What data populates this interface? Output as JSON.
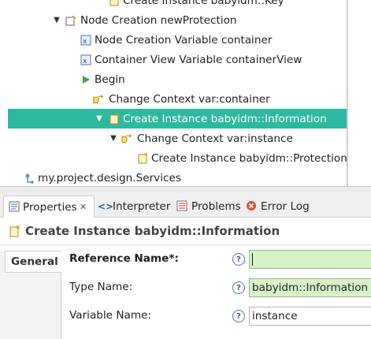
{
  "tree": {
    "rows": [
      {
        "label": "Create Instance babyidm::Key",
        "icon": "create-instance-icon"
      },
      {
        "label": "Node Creation newProtection",
        "icon": "node-creation-icon"
      },
      {
        "label": "Node Creation Variable container",
        "icon": "variable-icon"
      },
      {
        "label": "Container View Variable containerView",
        "icon": "variable-icon"
      },
      {
        "label": "Begin",
        "icon": "begin-arrow-icon"
      },
      {
        "label": "Change Context var:container",
        "icon": "change-context-icon"
      },
      {
        "label": "Create Instance babyidm::Information",
        "icon": "create-instance-icon"
      },
      {
        "label": "Change Context var:instance",
        "icon": "change-context-icon"
      },
      {
        "label": "Create Instance babyidm::Protection",
        "icon": "create-instance-icon"
      },
      {
        "label": "my.project.design.Services",
        "icon": "services-icon"
      }
    ]
  },
  "tabs": {
    "properties": "Properties",
    "properties_close": "✕",
    "interpreter": "Interpreter",
    "problems": "Problems",
    "error_log": "Error Log"
  },
  "properties": {
    "header": "Create Instance babyidm::Information",
    "vertical_tab": "General",
    "fields": {
      "reference_name_label": "Reference Name*:",
      "reference_name_value": "",
      "type_name_label": "Type Name:",
      "type_name_value": "babyidm::Information",
      "variable_name_label": "Variable Name:",
      "variable_name_value": "instance"
    },
    "help_glyph": "?"
  },
  "colors": {
    "selection": "#2db99f",
    "required_field": "#d7f2c9"
  }
}
